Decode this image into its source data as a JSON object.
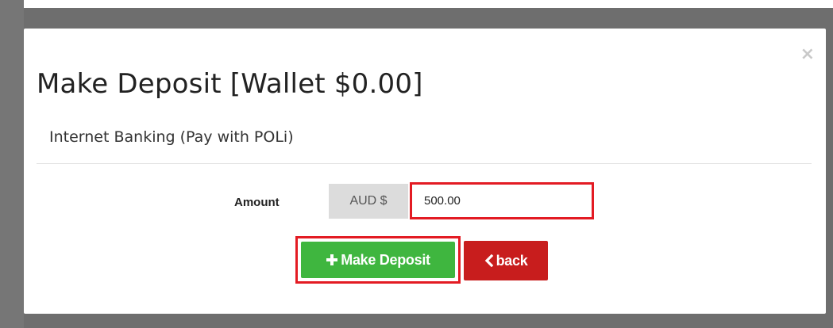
{
  "modal": {
    "title": "Make Deposit [Wallet $0.00]",
    "close_symbol": "×",
    "section_title": "Internet Banking (Pay with POLi)"
  },
  "form": {
    "amount_label": "Amount",
    "currency_prefix": "AUD $",
    "amount_value": "500.00"
  },
  "actions": {
    "deposit_label": "Make Deposit",
    "deposit_icon": "plus-icon",
    "back_label": "back",
    "back_icon": "chevron-left-icon"
  },
  "colors": {
    "deposit_button": "#3fb63f",
    "back_button": "#c81d1d",
    "highlight_border": "#e31b23"
  }
}
